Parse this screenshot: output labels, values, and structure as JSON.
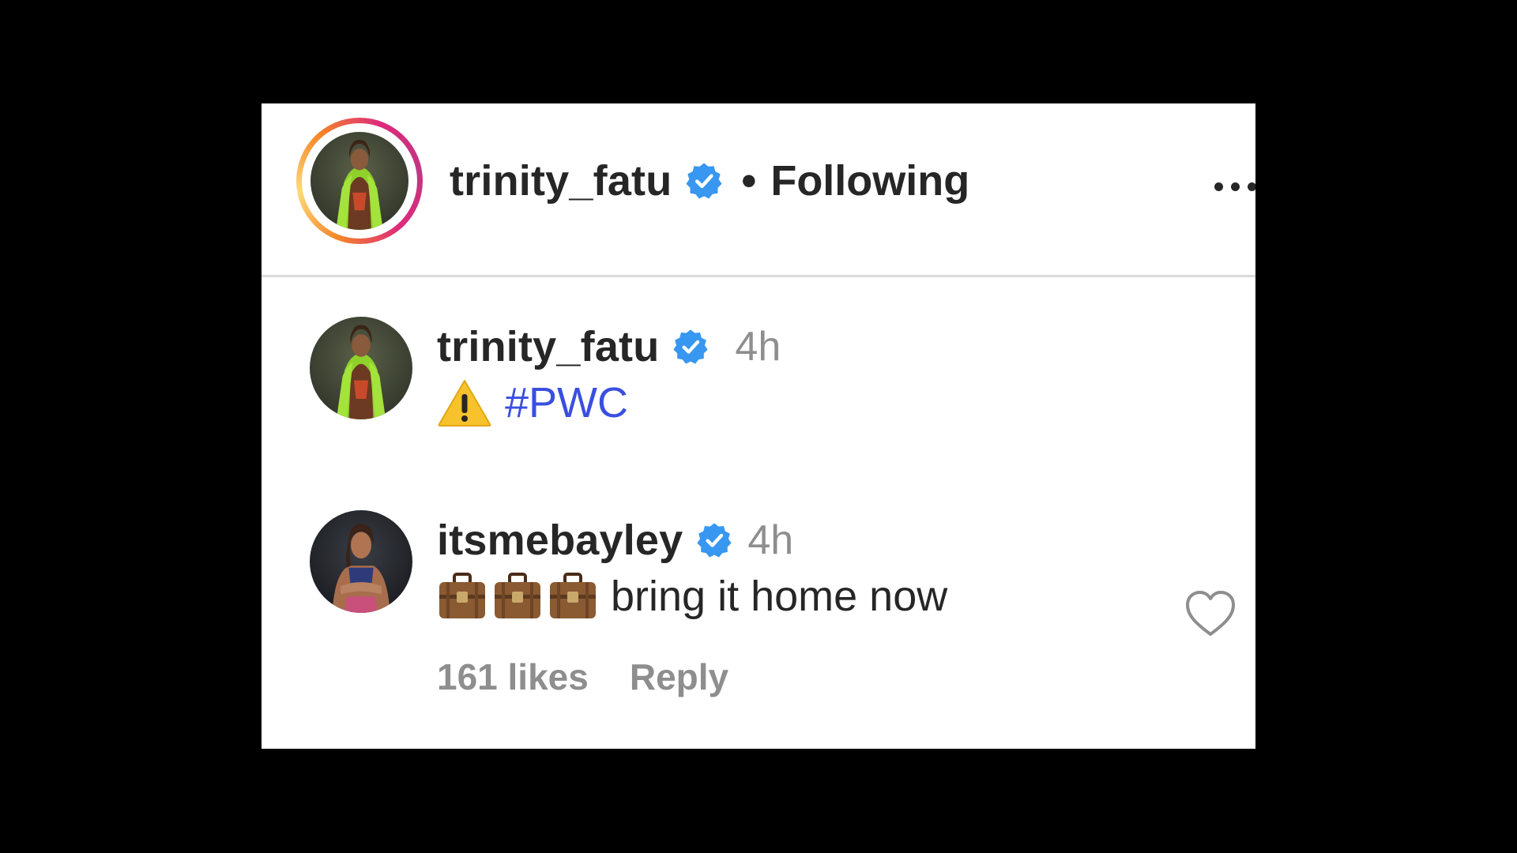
{
  "header": {
    "username": "trinity_fatu",
    "separator": "•",
    "follow_status": "Following",
    "verified_icon": "verified-badge-icon",
    "more_icon": "more-options-icon"
  },
  "comments": [
    {
      "username": "trinity_fatu",
      "timestamp": "4h",
      "emoji": "⚠️",
      "hashtag": "#PWC"
    },
    {
      "username": "itsmebayley",
      "timestamp": "4h",
      "emoji": "💼💼💼",
      "text": "bring it home now",
      "likes": "161 likes",
      "reply_label": "Reply",
      "like_icon": "heart-outline-icon"
    }
  ],
  "colors": {
    "background": "#000000",
    "panel": "#ffffff",
    "text": "#262626",
    "muted": "#8e8e8e",
    "hashtag": "#3a4fe0",
    "verified": "#3897f0",
    "divider": "#dbdbdb"
  }
}
